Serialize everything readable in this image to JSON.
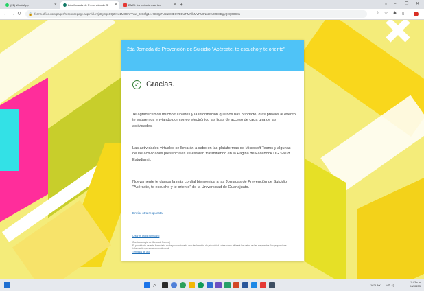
{
  "browser": {
    "tabs": [
      {
        "title": "(21) WhatsApp",
        "favicon_color": "#25d366",
        "active": false
      },
      {
        "title": "2da Jornada de Prevención de S",
        "favicon_color": "#117865",
        "active": true
      },
      {
        "title": "DMDI. La melodía más tier",
        "favicon_color": "#e53935",
        "active": false
      }
    ],
    "new_tab": "+",
    "url": "forms.office.com/pages/responsepage.aspx?id=r2jpEySgnOQ2lXvt1MOEhFVuuI_0xG8fg1e47tCQpFU5NEMEOVDBUTlMRlhMVFM0NzZKV0JDSDgyQ0Q0OS4u",
    "window_controls": [
      "⌄",
      "–",
      "❐",
      "✕"
    ]
  },
  "card": {
    "header_title": "2da Jornada de Prevención de Suicidio \"Acércate, te escucho y te oriento\"",
    "thanks": "Gracias.",
    "paragraphs": [
      "Te agradecemos mucho tu interés y la información que nos has brindado, días previos al evento te estaremos enviando por correo electrónico las ligas de acceso de cada una de las actividades.",
      "Las actividades virtuales se llevarán a cabo en las plataformas de Microsoft Teams y algunas de las actividades presenciales se estarán trasmitiendo en la Página de Facebook UG Salud Estudiantil.",
      "Nuevamente te damos la más cordial bienvenida a las Jornadas de Prevención de Suicidio \"Acércate, te escucho y te oriento\" de la Universidad de Guanajuato."
    ],
    "resubmit_link": "Enviar otra respuesta",
    "footer": {
      "create_form": "Crear mi propio formulario",
      "tech": "Con tecnología de Microsoft Forms |",
      "disclaimer": "El propietario de este formulario no ha proporcionado una declaración de privacidad sobre cómo utilizará los datos de las respuestas. No proporcione información personal o confidencial.",
      "terms": "Términos de uso"
    }
  },
  "taskbar": {
    "weather": "16°  LAX",
    "tray": "^  ⊡ ◁)",
    "time": "11:03 a. m.",
    "date": "18/08/2022"
  }
}
